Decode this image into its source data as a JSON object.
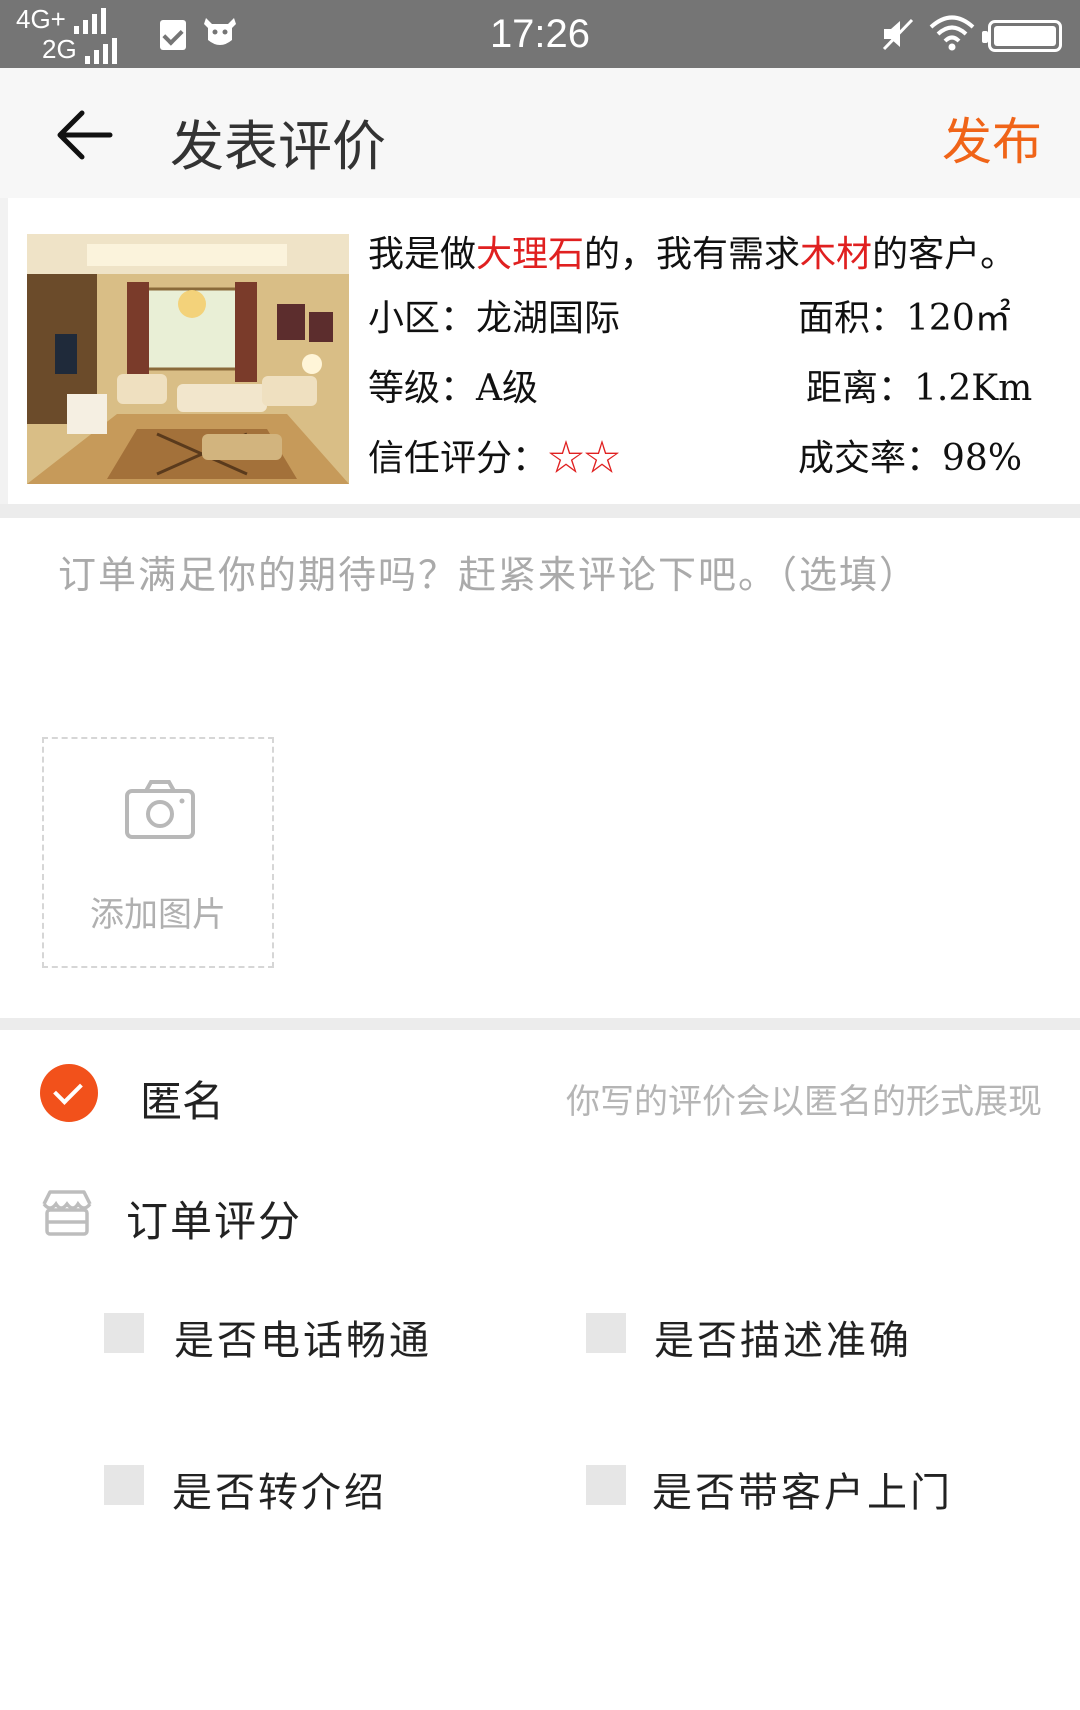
{
  "status_bar": {
    "network_top": "4G+",
    "network_bottom": "2G",
    "time": "17:26"
  },
  "header": {
    "title": "发表评价",
    "publish_label": "发布"
  },
  "card": {
    "headline_parts": [
      "我是做",
      "大理石",
      "的，我有需求",
      "木材",
      "的客户。"
    ],
    "community_label": "小区：",
    "community_value": "龙湖国际",
    "area_label": "面积：",
    "area_value": "120㎡",
    "level_label": "等级：",
    "level_value": "A级",
    "distance_label": "距离：",
    "distance_value": "1.2Km",
    "trust_label": "信任评分：",
    "trust_stars": "☆☆",
    "trust_rating": 2,
    "deal_rate_label": "成交率：",
    "deal_rate_value": "98%"
  },
  "comment": {
    "placeholder": "订单满足你的期待吗？赶紧来评论下吧。（选填）"
  },
  "photo": {
    "add_label": "添加图片"
  },
  "anonymous": {
    "label": "匿名",
    "hint": "你写的评价会以匿名的形式展现",
    "checked": true
  },
  "rating": {
    "title": "订单评分",
    "options": [
      {
        "label": "是否电话畅通",
        "checked": false
      },
      {
        "label": "是否描述准确",
        "checked": false
      },
      {
        "label": "是否转介绍",
        "checked": false
      },
      {
        "label": "是否带客户上门",
        "checked": false
      }
    ]
  },
  "colors": {
    "accent": "#f06418",
    "highlight_red": "#e02020",
    "status_bar": "#757575"
  },
  "icons": [
    "back-arrow-icon",
    "camera-icon",
    "check-icon",
    "store-icon",
    "wifi-icon",
    "mute-icon",
    "battery-icon",
    "signal-icon",
    "cow-icon"
  ]
}
